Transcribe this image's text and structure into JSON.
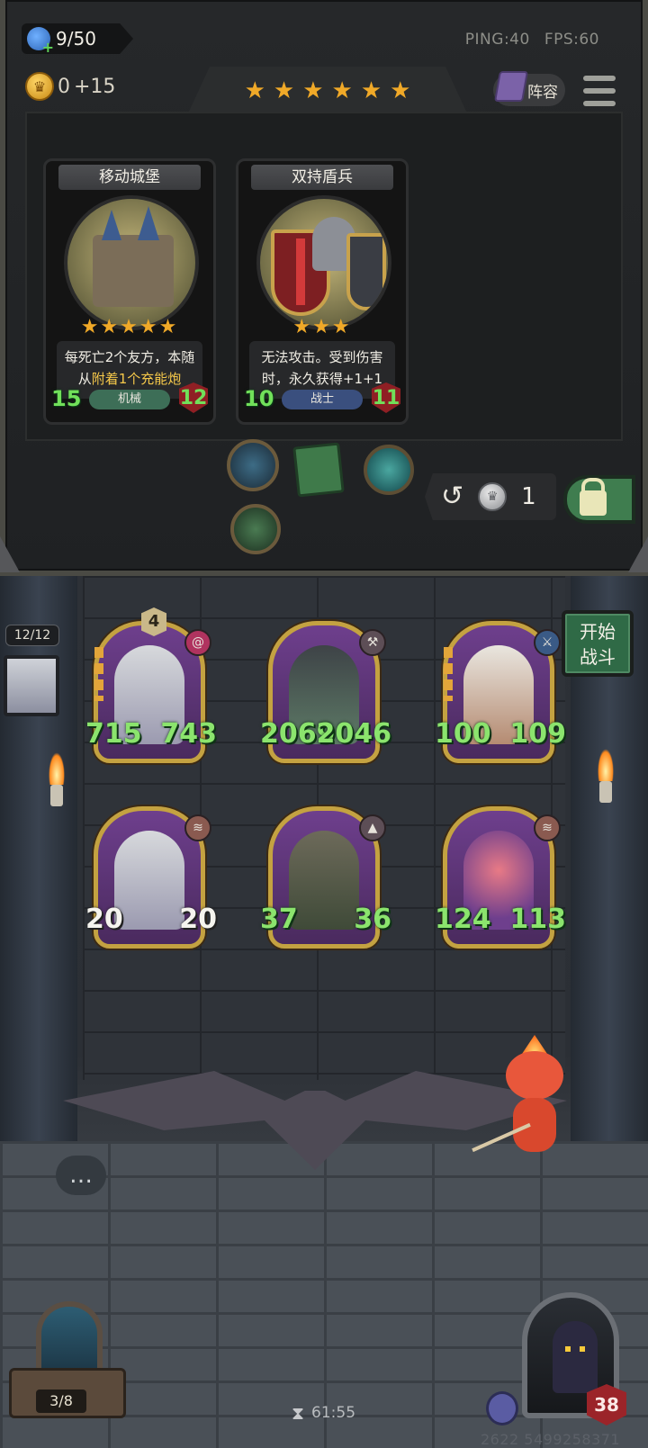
{
  "top_bar": {
    "population": "9/50",
    "gold": "0",
    "gold_income": "+15",
    "ping": "PING:40",
    "fps": "FPS:60",
    "lineup_label": "阵容",
    "tier_stars": 6
  },
  "shop_cards": [
    {
      "name": "移动城堡",
      "stars": "★★★★★",
      "desc_parts": [
        "每死亡2个友方，本随从",
        "附着1个",
        "充能炮"
      ],
      "attack": "15",
      "health": "12",
      "tribe": "机械",
      "tribe_color": "#3d6e57"
    },
    {
      "name": "双持盾兵",
      "stars": "★★★",
      "desc_parts": [
        "无法攻击。受到伤害时，永久获得+1+1"
      ],
      "attack": "10",
      "health": "11",
      "tribe": "战士",
      "tribe_color": "#3a4f7e"
    }
  ],
  "shop_items": [
    "compass-item",
    "spellbook-item",
    "mermaid-orb-item",
    "totem-item"
  ],
  "refresh": {
    "cost": "1"
  },
  "board": {
    "deck_counter": "12/12",
    "start_battle_line1": "开始",
    "start_battle_line2": "战斗",
    "minions": [
      {
        "attack": "715",
        "health": "743",
        "level": "4",
        "white_stats": false
      },
      {
        "attack": "2069",
        "health": "2046",
        "white_stats": false
      },
      {
        "attack": "100",
        "health": "109",
        "white_stats": false
      },
      {
        "attack": "20",
        "health": "20",
        "white_stats": true
      },
      {
        "attack": "37",
        "health": "36",
        "white_stats": false
      },
      {
        "attack": "124",
        "health": "113",
        "white_stats": false
      }
    ]
  },
  "bottom_hud": {
    "tavern_count": "3/8",
    "timer": "61:55",
    "hero_health": "38",
    "match_id": "2622 5499258371"
  },
  "colors": {
    "star": "#f0a928",
    "stat_green": "#8be46d",
    "start_button": "#2f6a46"
  }
}
